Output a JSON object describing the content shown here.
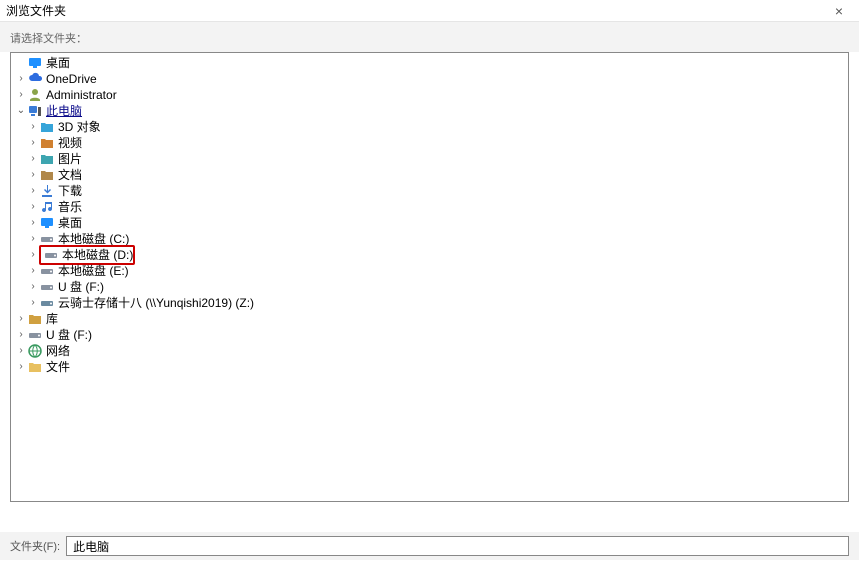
{
  "window": {
    "title": "浏览文件夹",
    "close_glyph": "×"
  },
  "instruction": "请选择文件夹：",
  "footer": {
    "label": "文件夹(F):",
    "value": "此电脑"
  },
  "tree": {
    "root": {
      "label": "桌面",
      "icon": "desktop"
    },
    "under_root": [
      {
        "label": "OneDrive",
        "icon": "cloud",
        "expander": ">"
      },
      {
        "label": "Administrator",
        "icon": "user",
        "expander": ">"
      }
    ],
    "this_pc": {
      "label": "此电脑",
      "icon": "pc",
      "expander": "v",
      "selected": true
    },
    "this_pc_children": [
      {
        "label": "3D 对象",
        "icon": "folder3d",
        "expander": ">"
      },
      {
        "label": "视频",
        "icon": "video",
        "expander": ">"
      },
      {
        "label": "图片",
        "icon": "pictures",
        "expander": ">"
      },
      {
        "label": "文档",
        "icon": "documents",
        "expander": ">"
      },
      {
        "label": "下载",
        "icon": "downloads",
        "expander": ">"
      },
      {
        "label": "音乐",
        "icon": "music",
        "expander": ">"
      },
      {
        "label": "桌面",
        "icon": "desktop-sm",
        "expander": ">"
      },
      {
        "label": "本地磁盘 (C:)",
        "icon": "drive",
        "expander": ">"
      },
      {
        "label": "本地磁盘 (D:)",
        "icon": "drive",
        "expander": ">",
        "highlight": true
      },
      {
        "label": "本地磁盘 (E:)",
        "icon": "drive",
        "expander": ">"
      },
      {
        "label": "U 盘 (F:)",
        "icon": "usb",
        "expander": ">"
      },
      {
        "label": "云骑士存储十八 (\\\\Yunqishi2019) (Z:)",
        "icon": "netdrive",
        "expander": ">"
      }
    ],
    "after_pc": [
      {
        "label": "库",
        "icon": "library",
        "expander": ">"
      },
      {
        "label": "U 盘 (F:)",
        "icon": "usb",
        "expander": ">"
      },
      {
        "label": "网络",
        "icon": "network",
        "expander": ">"
      },
      {
        "label": "文件",
        "icon": "folder",
        "expander": ">"
      }
    ]
  },
  "icons": {
    "desktop": "#1e90ff",
    "cloud": "#2d6cdf",
    "user": "#8aa44a",
    "pc": "#3a7bd5",
    "folder3d": "#36a4d9",
    "video": "#d08030",
    "pictures": "#3da5b0",
    "documents": "#b0884a",
    "downloads": "#3a7bd5",
    "music": "#3a7bd5",
    "desktop-sm": "#1e90ff",
    "drive": "#8892a0",
    "usb": "#8892a0",
    "netdrive": "#6a8aa0",
    "library": "#d0a040",
    "network": "#3a9a60",
    "folder": "#e8c060"
  }
}
